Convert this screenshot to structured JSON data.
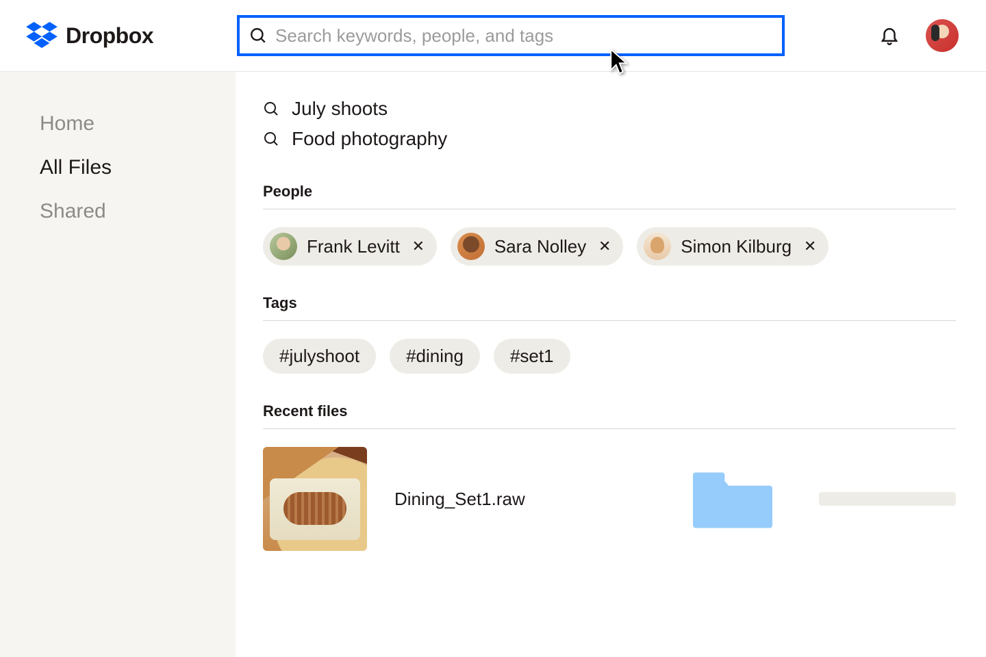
{
  "brand": {
    "name": "Dropbox"
  },
  "search": {
    "placeholder": "Search keywords, people, and tags",
    "value": ""
  },
  "sidebar": {
    "items": [
      {
        "label": "Home",
        "active": false
      },
      {
        "label": "All Files",
        "active": true
      },
      {
        "label": "Shared",
        "active": false
      }
    ]
  },
  "suggestions": [
    {
      "label": "July shoots"
    },
    {
      "label": "Food photography"
    }
  ],
  "sections": {
    "people": {
      "title": "People",
      "chips": [
        {
          "name": "Frank Levitt"
        },
        {
          "name": "Sara Nolley"
        },
        {
          "name": "Simon Kilburg"
        }
      ]
    },
    "tags": {
      "title": "Tags",
      "chips": [
        {
          "label": "#julyshoot"
        },
        {
          "label": "#dining"
        },
        {
          "label": "#set1"
        }
      ]
    },
    "recent": {
      "title": "Recent files",
      "files": [
        {
          "name": "Dining_Set1.raw"
        }
      ]
    }
  },
  "colors": {
    "accent": "#0061fe",
    "chip_bg": "#eeece6",
    "sidebar_bg": "#f7f5f2",
    "folder": "#96ccfb"
  }
}
